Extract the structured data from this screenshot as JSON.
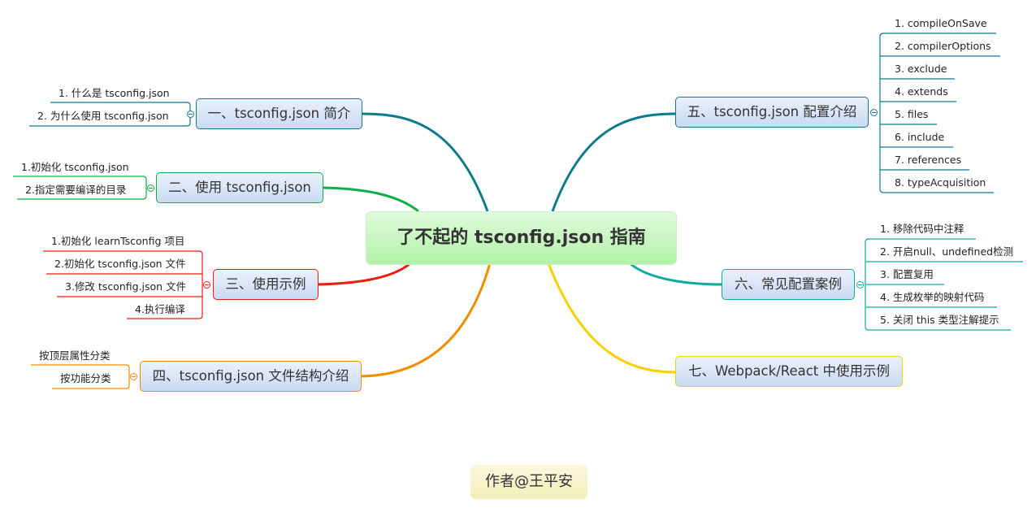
{
  "central_topic": "了不起的 tsconfig.json 指南",
  "author_label": "作者@王平安",
  "colors": {
    "branch1": "#0e7a8e",
    "branch2": "#0fae4a",
    "branch3": "#ee1c10",
    "branch4": "#f08c00",
    "branch5": "#0e7a8e",
    "branch6": "#10a99a",
    "branch7": "#f6d000"
  },
  "branches": [
    {
      "label": "一、tsconfig.json 简介",
      "children": [
        "1. 什么是 tsconfig.json",
        "2. 为什么使用 tsconfig.json"
      ]
    },
    {
      "label": "二、使用 tsconfig.json",
      "children": [
        "1.初始化 tsconfig.json",
        "2.指定需要编译的目录"
      ]
    },
    {
      "label": "三、使用示例",
      "children": [
        "1.初始化 learnTsconfig 项目",
        "2.初始化 tsconfig.json 文件",
        "3.修改 tsconfig.json 文件",
        "4.执行编译"
      ]
    },
    {
      "label": "四、tsconfig.json 文件结构介绍",
      "children": [
        "按顶层属性分类",
        "按功能分类"
      ]
    },
    {
      "label": "五、tsconfig.json 配置介绍",
      "children": [
        "1. compileOnSave",
        "2. compilerOptions",
        "3. exclude",
        "4. extends",
        "5. files",
        "6. include",
        "7. references",
        "8. typeAcquisition"
      ]
    },
    {
      "label": "六、常见配置案例",
      "children": [
        "1. 移除代码中注释",
        "2. 开启null、undefined检测",
        "3. 配置复用",
        "4. 生成枚举的映射代码",
        "5. 关闭 this 类型注解提示"
      ]
    },
    {
      "label": "七、Webpack/React 中使用示例",
      "children": []
    }
  ]
}
